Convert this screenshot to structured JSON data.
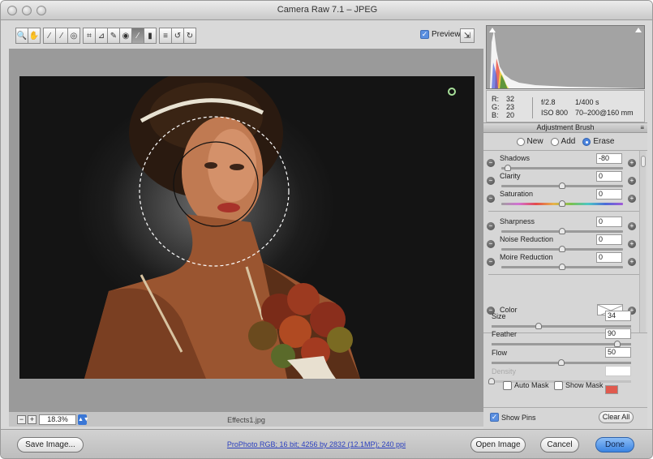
{
  "window": {
    "title": "Camera Raw 7.1  –  JPEG"
  },
  "toolbar": {
    "tools": [
      {
        "name": "zoom-tool",
        "icon": "🔍"
      },
      {
        "name": "hand-tool",
        "icon": "✋"
      },
      {
        "name": "white-balance-tool",
        "icon": "⁄"
      },
      {
        "name": "color-sampler-tool",
        "icon": "⁄"
      },
      {
        "name": "targeted-adjustment-tool",
        "icon": "◎"
      },
      {
        "name": "crop-tool",
        "icon": "⌗"
      },
      {
        "name": "straighten-tool",
        "icon": "⊿"
      },
      {
        "name": "spot-removal-tool",
        "icon": "✎"
      },
      {
        "name": "red-eye-tool",
        "icon": "◉"
      },
      {
        "name": "adjustment-brush-tool",
        "icon": "⁄"
      },
      {
        "name": "graduated-filter-tool",
        "icon": "▮"
      },
      {
        "name": "preferences",
        "icon": "≡"
      },
      {
        "name": "rotate-ccw",
        "icon": "↺"
      },
      {
        "name": "rotate-cw",
        "icon": "↻"
      }
    ],
    "preview_label": "Preview",
    "preview_checked": true
  },
  "image": {
    "zoom_value": "18.3%",
    "zoom_minus": "−",
    "zoom_plus": "+",
    "filename": "Effects1.jpg"
  },
  "info": {
    "r_label": "R:",
    "r_value": "32",
    "g_label": "G:",
    "g_value": "23",
    "b_label": "B:",
    "b_value": "20",
    "aperture": "f/2.8",
    "shutter": "1/400 s",
    "iso": "ISO 800",
    "lens": "70–200@160 mm"
  },
  "panel": {
    "title": "Adjustment Brush",
    "menu_icon": "≡",
    "modes": [
      {
        "label": "New",
        "selected": false
      },
      {
        "label": "Add",
        "selected": false
      },
      {
        "label": "Erase",
        "selected": true
      }
    ],
    "sliders": [
      {
        "label": "Shadows",
        "value": "-80",
        "position": 0.05
      },
      {
        "label": "Clarity",
        "value": "0",
        "position": 0.5
      },
      {
        "label": "Saturation",
        "value": "0",
        "position": 0.5
      },
      {
        "label": "Sharpness",
        "value": "0",
        "position": 0.5
      },
      {
        "label": "Noise Reduction",
        "value": "0",
        "position": 0.5
      },
      {
        "label": "Moire Reduction",
        "value": "0",
        "position": 0.5
      }
    ],
    "color_label": "Color",
    "brush": [
      {
        "label": "Size",
        "value": "34",
        "position": 0.34
      },
      {
        "label": "Feather",
        "value": "90",
        "position": 0.9
      },
      {
        "label": "Flow",
        "value": "50",
        "position": 0.5
      },
      {
        "label": "Density",
        "value": "",
        "position": 0.0,
        "disabled": true
      }
    ],
    "auto_mask_label": "Auto Mask",
    "show_mask_label": "Show Mask",
    "show_mask_color": "#e05a4e",
    "show_pins_label": "Show Pins",
    "clear_all_label": "Clear All"
  },
  "bottom": {
    "save_image": "Save Image...",
    "workflow": "ProPhoto RGB; 16 bit; 4256 by 2832 (12.1MP); 240 ppi",
    "open_image": "Open Image",
    "cancel": "Cancel",
    "done": "Done"
  },
  "colors": {
    "accent": "#3b84e2",
    "pin": "#a8e09a"
  }
}
